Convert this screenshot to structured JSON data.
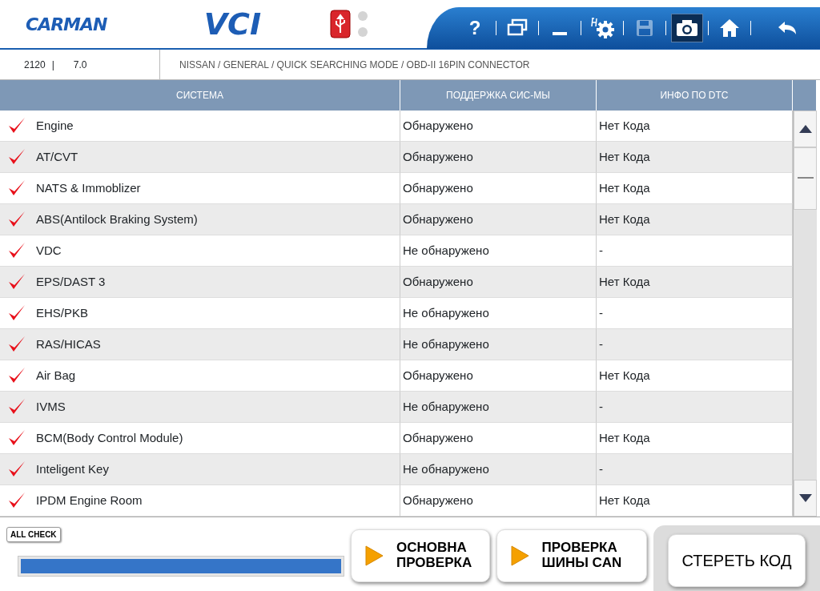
{
  "app": {
    "logo": "CARMAN",
    "product": "VCI"
  },
  "toolbar": [
    {
      "kind": "help",
      "label": "?",
      "disabled": false,
      "selected": false
    },
    {
      "kind": "window",
      "disabled": false,
      "selected": false
    },
    {
      "kind": "minimize",
      "disabled": false,
      "selected": false
    },
    {
      "kind": "settings",
      "disabled": false,
      "selected": false
    },
    {
      "kind": "save",
      "disabled": true,
      "selected": false
    },
    {
      "kind": "camera",
      "disabled": false,
      "selected": true
    },
    {
      "kind": "home",
      "disabled": false,
      "selected": false
    },
    {
      "kind": "back",
      "disabled": false,
      "selected": false
    }
  ],
  "info_bar": {
    "code": "2120",
    "separator": "|",
    "version": "7.0",
    "path": "NISSAN / GENERAL / QUICK SEARCHING MODE / OBD-II 16PIN CONNECTOR"
  },
  "table": {
    "columns": [
      "СИСТЕМА",
      "ПОДДЕРЖКА СИС-МЫ",
      "ИНФО ПО DTC"
    ],
    "rows": [
      {
        "checked": true,
        "system": "Engine",
        "support": "Обнаружено",
        "dtc": "Нет Кода"
      },
      {
        "checked": true,
        "system": "AT/CVT",
        "support": "Обнаружено",
        "dtc": "Нет Кода"
      },
      {
        "checked": true,
        "system": "NATS & Immoblizer",
        "support": "Обнаружено",
        "dtc": "Нет Кода"
      },
      {
        "checked": true,
        "system": "ABS(Antilock Braking System)",
        "support": "Обнаружено",
        "dtc": "Нет Кода"
      },
      {
        "checked": true,
        "system": "VDC",
        "support": "Не обнаружено",
        "dtc": "-"
      },
      {
        "checked": true,
        "system": "EPS/DAST 3",
        "support": "Обнаружено",
        "dtc": "Нет Кода"
      },
      {
        "checked": true,
        "system": "EHS/PKB",
        "support": "Не обнаружено",
        "dtc": "-"
      },
      {
        "checked": true,
        "system": "RAS/HICAS",
        "support": "Не обнаружено",
        "dtc": "-"
      },
      {
        "checked": true,
        "system": "Air Bag",
        "support": "Обнаружено",
        "dtc": "Нет Кода"
      },
      {
        "checked": true,
        "system": "IVMS",
        "support": "Не обнаружено",
        "dtc": "-"
      },
      {
        "checked": true,
        "system": "BCM(Body Control Module)",
        "support": "Обнаружено",
        "dtc": "Нет Кода"
      },
      {
        "checked": true,
        "system": "Inteligent Key",
        "support": "Не обнаружено",
        "dtc": "-"
      },
      {
        "checked": true,
        "system": "IPDM Engine Room",
        "support": "Обнаружено",
        "dtc": "Нет Кода"
      }
    ]
  },
  "bottom": {
    "all_check": "ALL CHECK",
    "progress": {
      "level": 1
    },
    "actions": [
      {
        "kind": "play",
        "label": "ОСНОВНА ПРОВЕРКА"
      },
      {
        "kind": "play",
        "label": "ПРОВЕРКА ШИНЫ CAN"
      },
      {
        "kind": "plain",
        "label": "СТЕРЕТЬ КОД"
      }
    ]
  }
}
